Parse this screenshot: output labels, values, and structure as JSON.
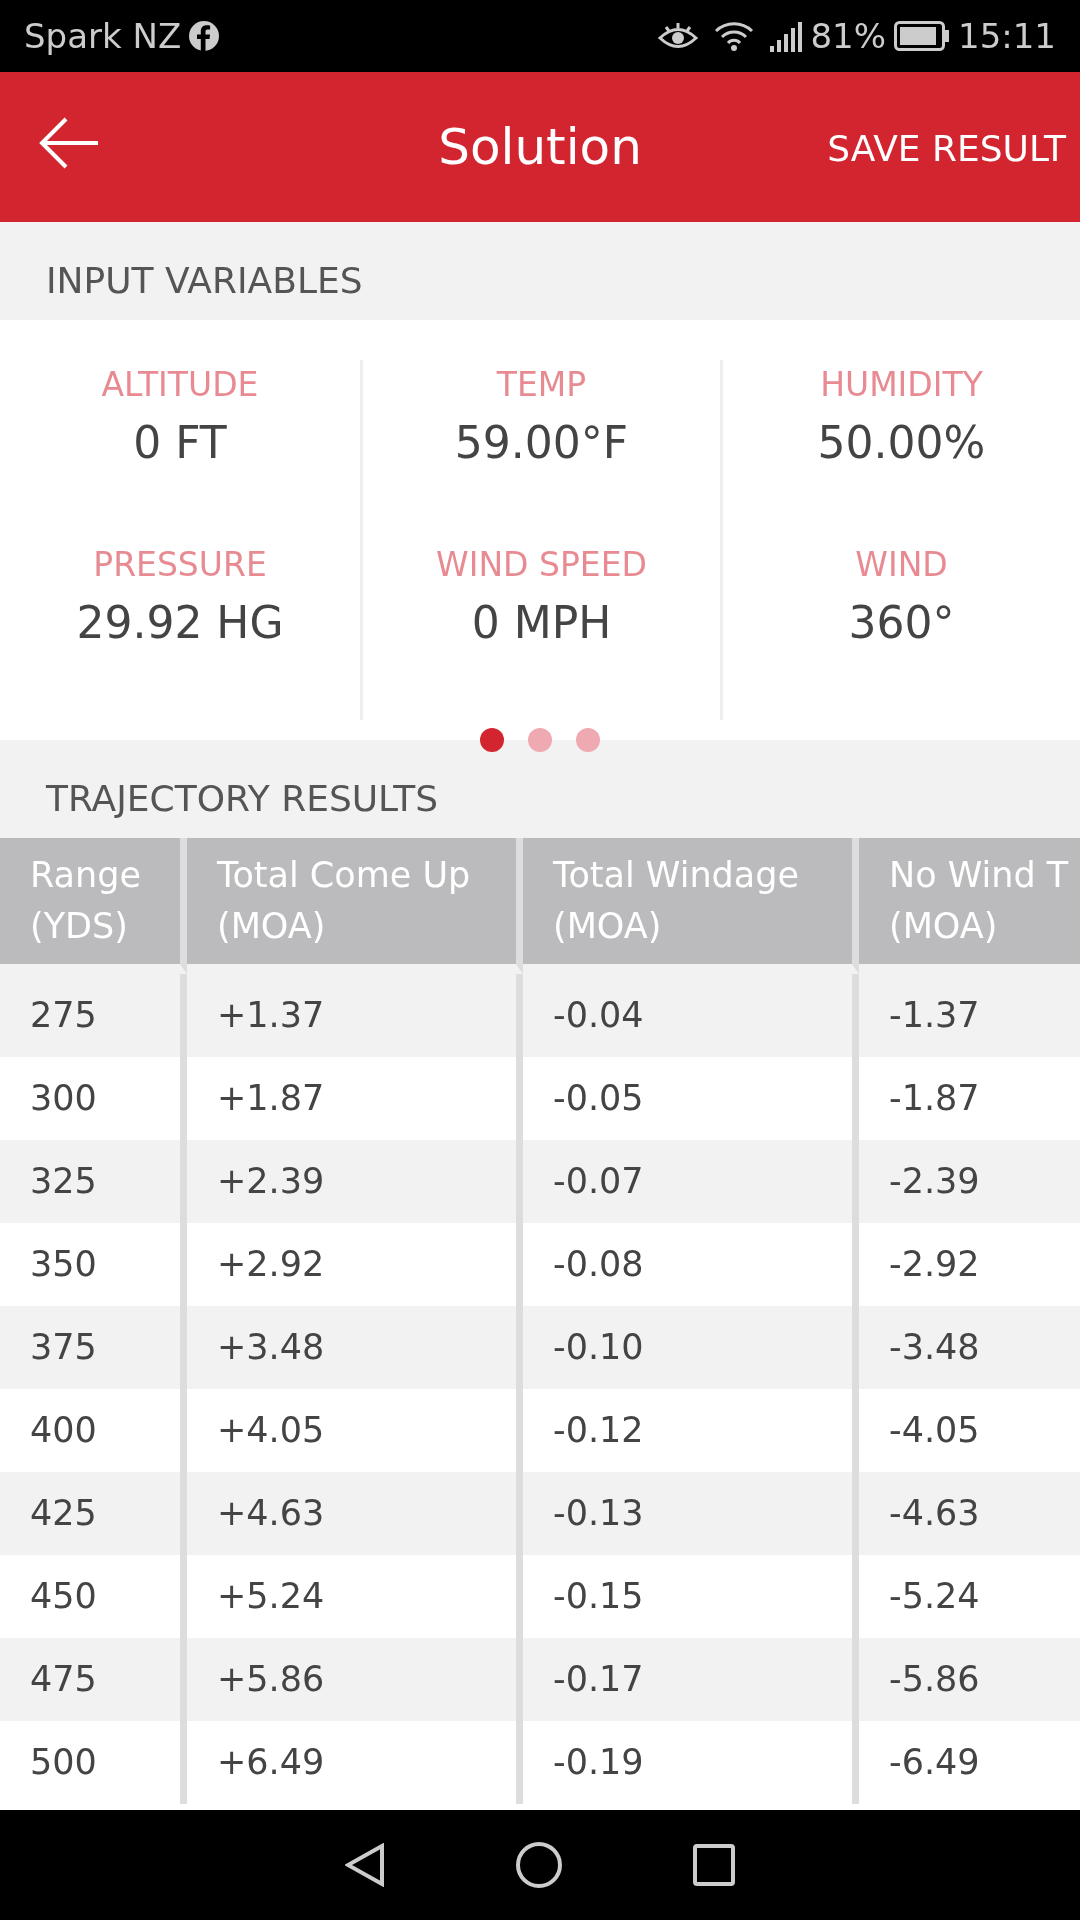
{
  "status_bar": {
    "carrier": "Spark NZ",
    "battery": "81%",
    "time": "15:11"
  },
  "app_bar": {
    "title": "Solution",
    "action": "SAVE RESULT"
  },
  "input_variables": {
    "heading": "INPUT VARIABLES",
    "items": [
      {
        "label": "ALTITUDE",
        "value": "0 FT"
      },
      {
        "label": "TEMP",
        "value": "59.00°F"
      },
      {
        "label": "HUMIDITY",
        "value": "50.00%"
      },
      {
        "label": "PRESSURE",
        "value": "29.92 HG"
      },
      {
        "label": "WIND SPEED",
        "value": "0 MPH"
      },
      {
        "label": "WIND",
        "value": "360°"
      }
    ],
    "pages": [
      {
        "selected": true
      },
      {
        "selected": false
      },
      {
        "selected": false
      }
    ]
  },
  "trajectory": {
    "heading": "TRAJECTORY RESULTS",
    "columns": [
      "Range (YDS)",
      "Total Come Up (MOA)",
      "Total Windage (MOA)",
      "No Wind T (MOA)"
    ],
    "rows": [
      [
        "275",
        "+1.37",
        "-0.04",
        "-1.37"
      ],
      [
        "300",
        "+1.87",
        "-0.05",
        "-1.87"
      ],
      [
        "325",
        "+2.39",
        "-0.07",
        "-2.39"
      ],
      [
        "350",
        "+2.92",
        "-0.08",
        "-2.92"
      ],
      [
        "375",
        "+3.48",
        "-0.10",
        "-3.48"
      ],
      [
        "400",
        "+4.05",
        "-0.12",
        "-4.05"
      ],
      [
        "425",
        "+4.63",
        "-0.13",
        "-4.63"
      ],
      [
        "450",
        "+5.24",
        "-0.15",
        "-5.24"
      ],
      [
        "475",
        "+5.86",
        "-0.17",
        "-5.86"
      ],
      [
        "500",
        "+6.49",
        "-0.19",
        "-6.49"
      ]
    ]
  }
}
